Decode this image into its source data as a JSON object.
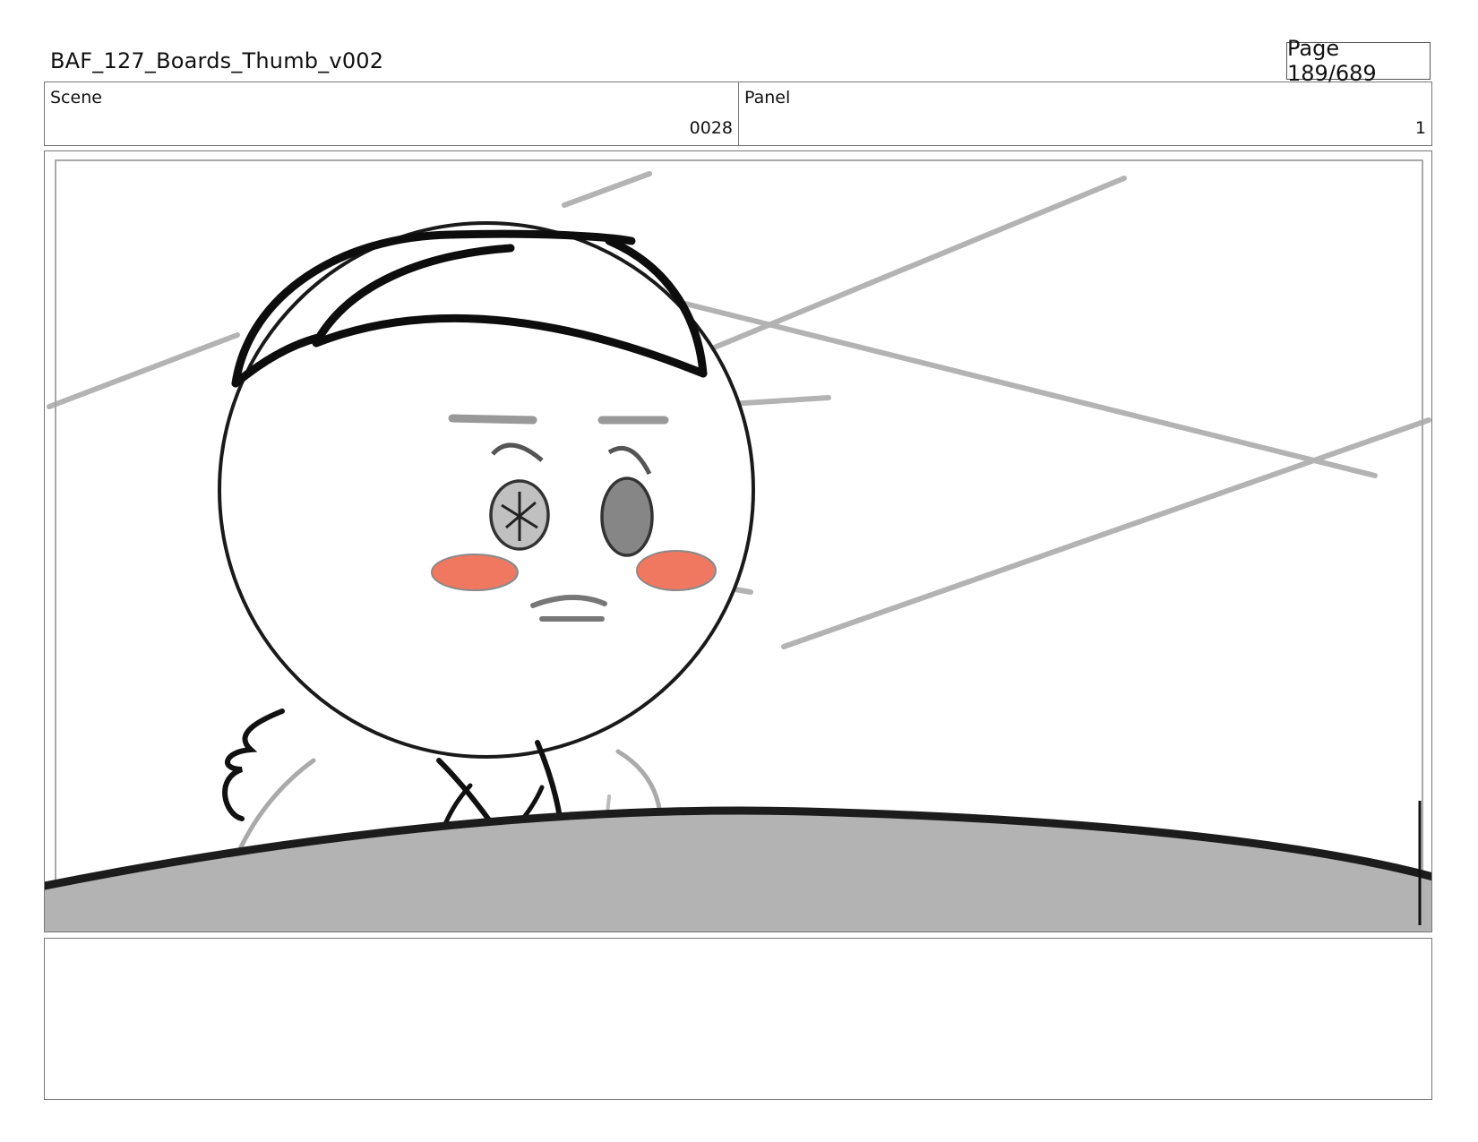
{
  "header": {
    "document_title": "BAF_127_Boards_Thumb_v002",
    "page_label": "Page 189/689"
  },
  "info": {
    "scene_label": "Scene",
    "scene_value": "0028",
    "panel_label": "Panel",
    "panel_value": "1"
  },
  "artwork": {
    "subject": "storyboard-sketch",
    "cheek_color": "#f07860",
    "table_color": "#b3b3b3",
    "line_color": "#111111"
  },
  "notes": {
    "text": ""
  }
}
